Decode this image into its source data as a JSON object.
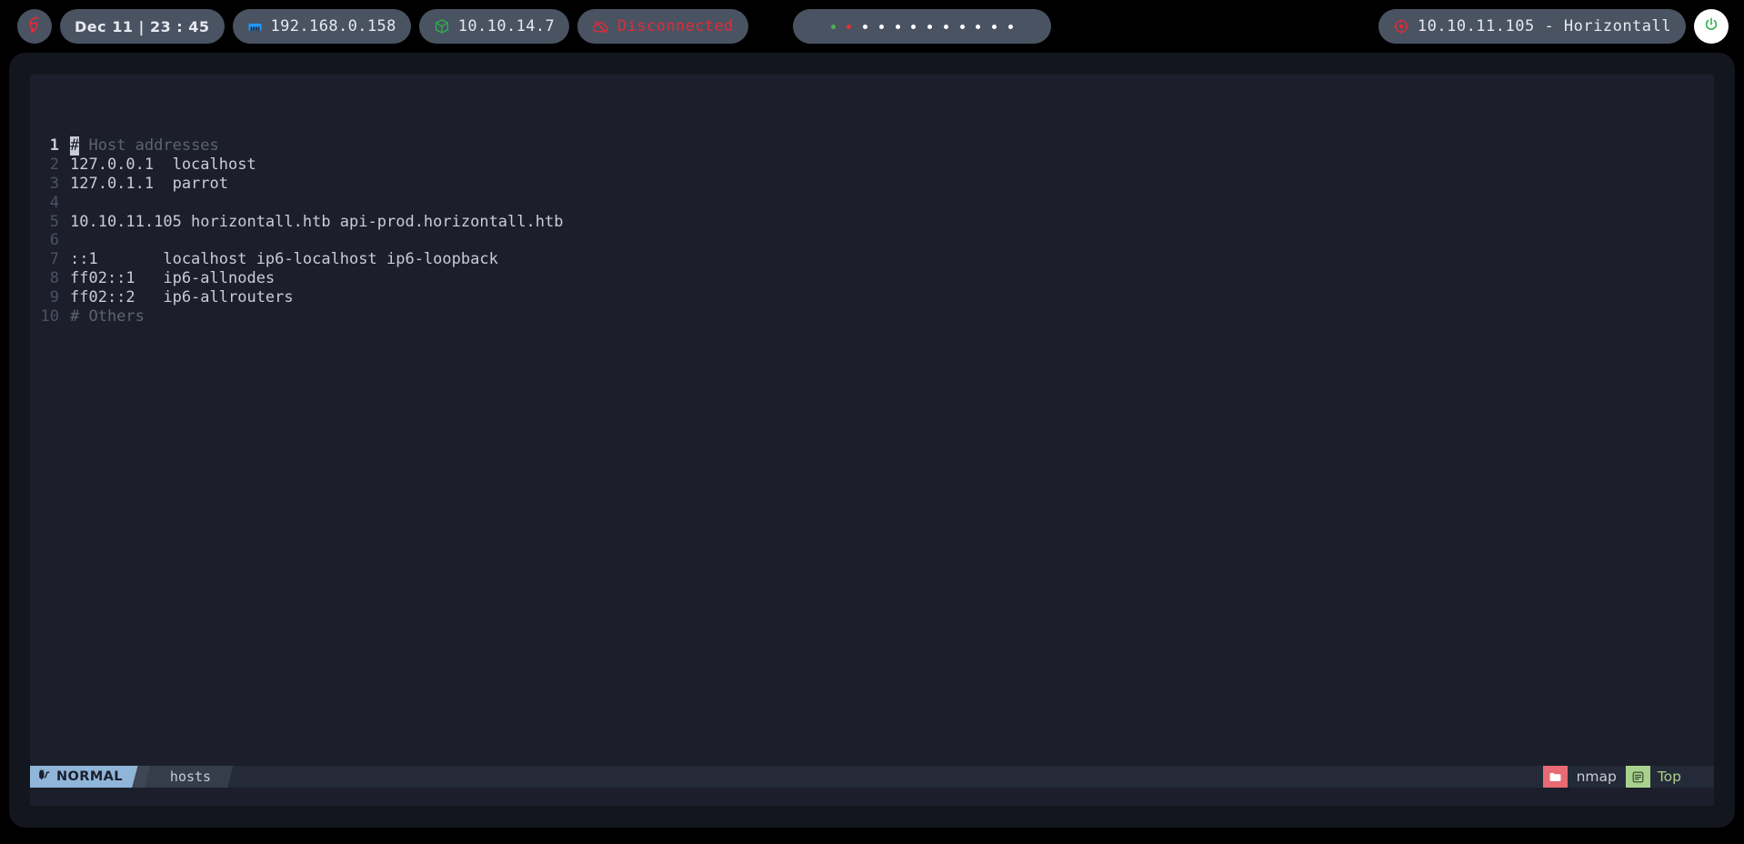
{
  "topbar": {
    "logo_icon": "parrot-logo-icon",
    "clock": "Dec 11 | 23 : 45",
    "lan": {
      "icon": "ethernet-icon",
      "label": "192.168.0.158"
    },
    "vpn": {
      "icon": "cube-icon",
      "label": "10.10.14.7"
    },
    "connection": {
      "icon": "cloud-off-icon",
      "label": "Disconnected",
      "color": "#e02b3a"
    },
    "workspaces": [
      {
        "state": "green",
        "color": "#4caf50"
      },
      {
        "state": "red",
        "color": "#e03030"
      },
      {
        "state": "white",
        "color": "#ffffff"
      },
      {
        "state": "white",
        "color": "#ffffff"
      },
      {
        "state": "white",
        "color": "#ffffff"
      },
      {
        "state": "white",
        "color": "#ffffff"
      },
      {
        "state": "white",
        "color": "#ffffff"
      },
      {
        "state": "white",
        "color": "#ffffff"
      },
      {
        "state": "white",
        "color": "#ffffff"
      },
      {
        "state": "white",
        "color": "#ffffff"
      },
      {
        "state": "white",
        "color": "#ffffff"
      },
      {
        "state": "white",
        "color": "#ffffff"
      }
    ],
    "target": {
      "icon": "crosshair-icon",
      "label": "10.10.11.105 - Horizontall"
    },
    "power": {
      "icon": "power-icon",
      "color": "#2bb24c"
    }
  },
  "editor": {
    "lines": [
      {
        "num": "1",
        "text": "# Host addresses",
        "style": "comment",
        "cursor_char": "#",
        "cursor": true
      },
      {
        "num": "2",
        "text": "127.0.0.1  localhost",
        "style": "normal"
      },
      {
        "num": "3",
        "text": "127.0.1.1  parrot",
        "style": "normal"
      },
      {
        "num": "4",
        "text": "",
        "style": "normal"
      },
      {
        "num": "5",
        "text": "10.10.11.105 horizontall.htb api-prod.horizontall.htb",
        "style": "normal"
      },
      {
        "num": "6",
        "text": "",
        "style": "normal"
      },
      {
        "num": "7",
        "text": "::1       localhost ip6-localhost ip6-loopback",
        "style": "normal"
      },
      {
        "num": "8",
        "text": "ff02::1   ip6-allnodes",
        "style": "normal"
      },
      {
        "num": "9",
        "text": "ff02::2   ip6-allrouters",
        "style": "normal"
      },
      {
        "num": "10",
        "text": "# Others",
        "style": "comment"
      }
    ]
  },
  "statusbar": {
    "mode_icon": "vim-logo-icon",
    "mode": "NORMAL",
    "filename": "hosts",
    "folder_icon": "folder-icon",
    "directory": "nmap",
    "lines_icon": "lines-icon",
    "position": "Top"
  }
}
